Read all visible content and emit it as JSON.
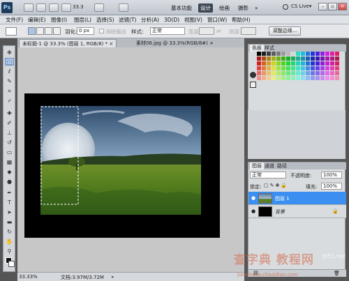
{
  "app": {
    "logo": "Ps"
  },
  "titlebar": {
    "zoom": "33.3",
    "workspaces": [
      "基本功能",
      "设计",
      "绘画",
      "摄影"
    ],
    "active_workspace": "设计",
    "more": "»",
    "cs_live": "CS Live▾"
  },
  "menu": [
    "文件(F)",
    "编辑(E)",
    "图像(I)",
    "图层(L)",
    "选择(S)",
    "滤镜(T)",
    "分析(A)",
    "3D(D)",
    "视图(V)",
    "窗口(W)",
    "帮助(H)"
  ],
  "options": {
    "feather_label": "羽化:",
    "feather_value": "0 px",
    "antialias_label": "消除锯齿",
    "style_label": "样式:",
    "style_value": "正常",
    "width_label": "宽度:",
    "height_label": "高度:",
    "refine_edge": "调整边缘..."
  },
  "tabs": [
    {
      "label": "未标题-1 @ 33.3% (图层 1, RGB/8) *",
      "close": "×"
    },
    {
      "label": "素材06.jpg @ 33.3%(RGB/8#)",
      "close": "×"
    }
  ],
  "status": {
    "zoom": "33.33%",
    "doc": "文档:3.97M/3.72M"
  },
  "panels": {
    "swatch_tabs": [
      "色板",
      "样式"
    ],
    "layers_tabs": [
      "图层",
      "通道",
      "路径"
    ],
    "blend_mode": "正常",
    "opacity_label": "不透明度:",
    "opacity_value": "100%",
    "lock_label": "锁定:",
    "fill_label": "填充:",
    "fill_value": "100%",
    "layers": [
      {
        "name": "图层 1",
        "selected": true
      },
      {
        "name": "背景",
        "selected": false
      }
    ]
  },
  "watermark": {
    "text": "查字典 教程网",
    "url": "jb51.net",
    "sub": "jiaocheng.chazidian.com"
  },
  "colors": {
    "accent": "#3a8ff0",
    "toolbar": "#d3d6da",
    "canvas": "#c7c7c7"
  }
}
